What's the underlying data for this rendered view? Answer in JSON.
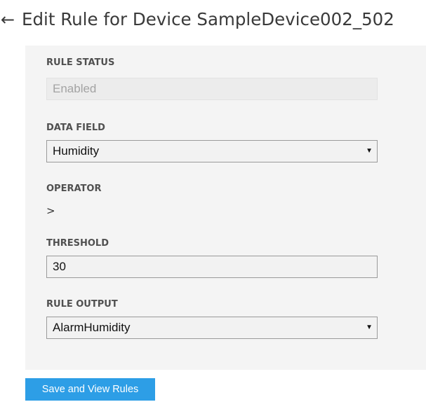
{
  "header": {
    "back_icon": "back-arrow-icon",
    "back_glyph": "←",
    "title": "Edit Rule for Device SampleDevice002_502"
  },
  "form": {
    "rule_status": {
      "label": "RULE STATUS",
      "value": "Enabled"
    },
    "data_field": {
      "label": "DATA FIELD",
      "value": "Humidity"
    },
    "operator": {
      "label": "OPERATOR",
      "value": ">"
    },
    "threshold": {
      "label": "THRESHOLD",
      "value": "30"
    },
    "rule_output": {
      "label": "RULE OUTPUT",
      "value": "AlarmHumidity"
    }
  },
  "dropdown_caret": "▼",
  "actions": {
    "save_label": "Save and View Rules"
  },
  "colors": {
    "accent": "#2d9ee6",
    "panel_background": "#f4f4f4",
    "disabled_text": "#a3a3a3"
  }
}
